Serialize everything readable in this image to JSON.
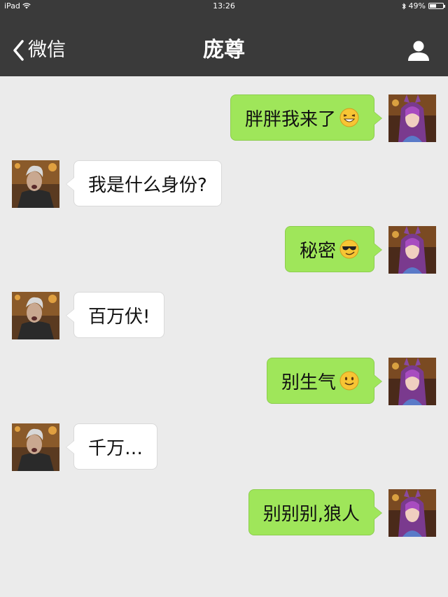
{
  "status_bar": {
    "device": "iPad",
    "time": "13:26",
    "battery": "49%",
    "battery_level": 0.49
  },
  "nav": {
    "back_label": "微信",
    "title": "庞尊",
    "profile_icon": "person-icon"
  },
  "colors": {
    "nav_bg": "#3a3a3a",
    "chat_bg": "#ebebeb",
    "outgoing_bubble": "#9fe65a",
    "incoming_bubble": "#ffffff"
  },
  "messages": [
    {
      "direction": "out",
      "text": "胖胖我来了",
      "emoji": "grinning-squint-face-icon"
    },
    {
      "direction": "in",
      "text": "我是什么身份?",
      "emoji": ""
    },
    {
      "direction": "out",
      "text": "秘密",
      "emoji": "sunglasses-face-icon"
    },
    {
      "direction": "in",
      "text": "百万伏!",
      "emoji": ""
    },
    {
      "direction": "out",
      "text": "别生气",
      "emoji": "smiling-face-icon"
    },
    {
      "direction": "in",
      "text": "千万…",
      "emoji": ""
    },
    {
      "direction": "out",
      "text": "别别别,狼人",
      "emoji": ""
    }
  ]
}
